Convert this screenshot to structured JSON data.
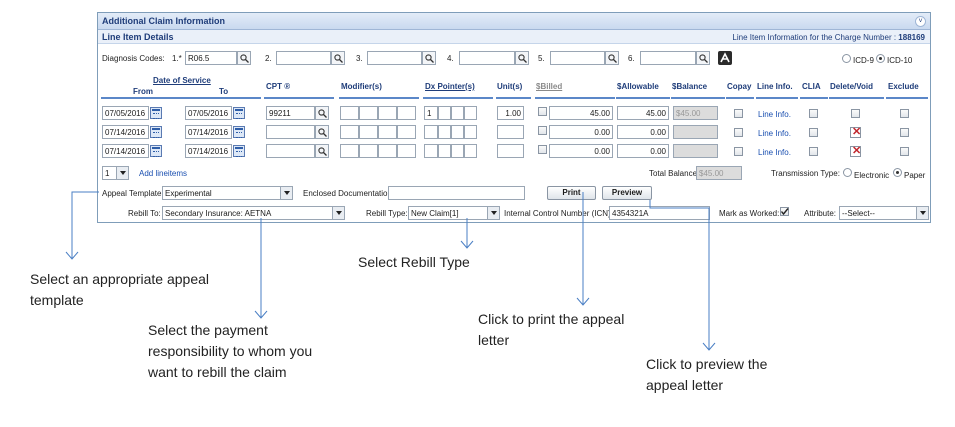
{
  "panel": {
    "title": "Additional Claim Information",
    "subtitle": "Line Item Details",
    "charge_note_label": "Line Item Information for the Charge Number :",
    "charge_number": "188169"
  },
  "diagnosis": {
    "label": "Diagnosis Codes:",
    "codes": [
      {
        "num": "1.*",
        "value": "R06.5"
      },
      {
        "num": "2.",
        "value": ""
      },
      {
        "num": "3.",
        "value": ""
      },
      {
        "num": "4.",
        "value": ""
      },
      {
        "num": "5.",
        "value": ""
      },
      {
        "num": "6.",
        "value": ""
      }
    ],
    "icd9": "ICD-9",
    "icd10": "ICD-10",
    "selected": "ICD-10"
  },
  "columns": {
    "date_of_service": "Date of Service",
    "from": "From",
    "to": "To",
    "cpt": "CPT ®",
    "modifiers": "Modifier(s)",
    "dx_pointers": "Dx Pointer(s)",
    "units": "Unit(s)",
    "billed": "$Billed",
    "allowable": "$Allowable",
    "balance": "$Balance",
    "copay": "Copay",
    "line_info": "Line Info.",
    "clia": "CLIA",
    "delete_void": "Delete/Void",
    "exclude": "Exclude"
  },
  "rows": [
    {
      "from": "07/05/2016",
      "to": "07/05/2016",
      "cpt": "99211",
      "dx1": "1",
      "units": "1.00",
      "billed": "45.00",
      "allowable": "45.00",
      "balance": "$45.00",
      "line_info": "Line Info.",
      "deleted": false
    },
    {
      "from": "07/14/2016",
      "to": "07/14/2016",
      "cpt": "",
      "dx1": "",
      "units": "",
      "billed": "0.00",
      "allowable": "0.00",
      "balance": "",
      "line_info": "Line Info.",
      "deleted": true
    },
    {
      "from": "07/14/2016",
      "to": "07/14/2016",
      "cpt": "",
      "dx1": "",
      "units": "",
      "billed": "0.00",
      "allowable": "0.00",
      "balance": "",
      "line_info": "Line Info.",
      "deleted": true
    }
  ],
  "footer": {
    "add_count": "1",
    "add_lineitems": "Add lineitems",
    "total_balance_label": "Total Balance:",
    "total_balance": "$45.00",
    "transmission_label": "Transmission Type:",
    "electronic": "Electronic",
    "paper": "Paper",
    "transmission_selected": "Paper"
  },
  "appeal": {
    "template_label": "Appeal Template:",
    "template_value": "Experimental",
    "enclosed_label": "Enclosed Documentation:",
    "enclosed_value": "",
    "print": "Print",
    "preview": "Preview"
  },
  "rebill": {
    "rebill_to_label": "Rebill To:",
    "rebill_to_value": "Secondary Insurance: AETNA",
    "rebill_type_label": "Rebill Type:",
    "rebill_type_value": "New Claim[1]",
    "icn_label": "Internal Control Number (ICN):",
    "icn_value": "4354321A",
    "mark_worked_label": "Mark as Worked:",
    "mark_worked": true,
    "attribute_label": "Attribute:",
    "attribute_value": "--Select--"
  },
  "callouts": {
    "appeal_template": "Select an appropriate appeal template",
    "rebill_to": "Select the payment responsibility to whom you want to rebill the claim",
    "rebill_type": "Select Rebill Type",
    "print": "Click to print the appeal letter",
    "preview": "Click to preview the appeal letter"
  },
  "colors": {
    "header_text": "#1f3d7a",
    "link": "#1a4fb0",
    "delete_mark": "#c0262c",
    "callout_line": "#4a7fc4"
  }
}
